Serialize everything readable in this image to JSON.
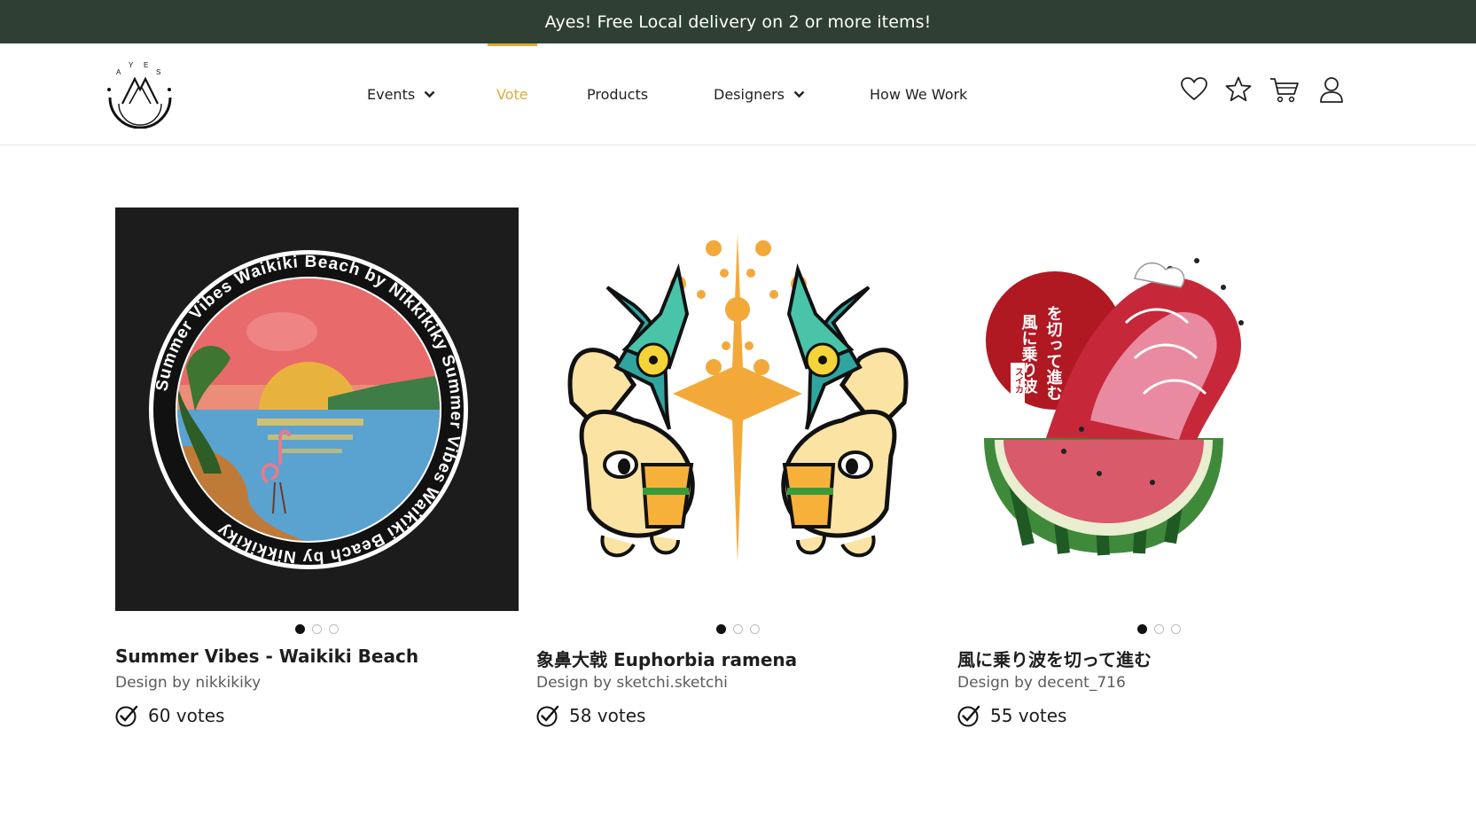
{
  "promo": {
    "text": "Ayes! Free Local delivery on 2 or more items!"
  },
  "brand": {
    "logo_letters": [
      "A",
      "Y",
      "E",
      "S"
    ],
    "accent_color": "#e1a93a",
    "promo_bg": "#2f3f34"
  },
  "nav": {
    "items": [
      {
        "label": "Events",
        "has_dropdown": true
      },
      {
        "label": "Vote",
        "active": true
      },
      {
        "label": "Products"
      },
      {
        "label": "Designers",
        "has_dropdown": true
      },
      {
        "label": "How We Work"
      }
    ]
  },
  "header_icons": [
    "heart-icon",
    "star-icon",
    "cart-icon",
    "user-icon"
  ],
  "designs": [
    {
      "title": "Summer Vibes - Waikiki Beach",
      "designer": "Design by nikkikiky",
      "votes": "60 votes",
      "badge_text": "Summer Vibes  Waikiki Beach  by Nikkikiky  Summer Vibes  Waikiki Beach  by Nikkikiky",
      "carousel_dots": 3,
      "active_dot": 0
    },
    {
      "title": "象鼻大戟 Euphorbia ramena",
      "designer": "Design by sketchi.sketchi",
      "votes": "58 votes",
      "carousel_dots": 3,
      "active_dot": 0
    },
    {
      "title": "風に乗り波を切って進む",
      "designer": "Design by decent_716",
      "votes": "55 votes",
      "art_text_1": "風に乗り波",
      "art_text_2": "を切って進む",
      "art_text_3": "スイカ",
      "carousel_dots": 3,
      "active_dot": 0
    }
  ]
}
